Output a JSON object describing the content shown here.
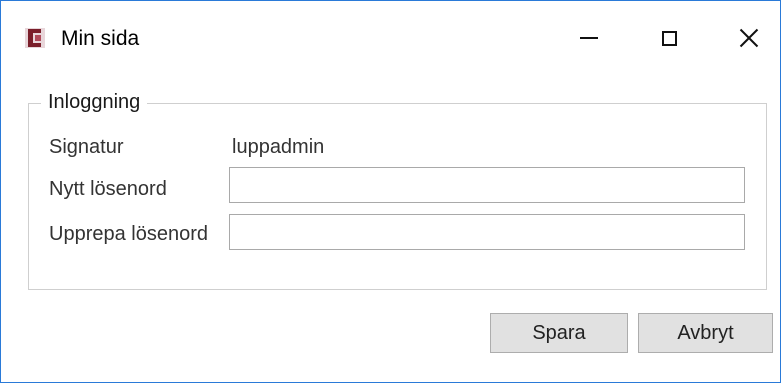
{
  "window": {
    "title": "Min sida",
    "app_icon": "app-icon",
    "controls": {
      "minimize_icon": "minimize-icon",
      "maximize_icon": "maximize-icon",
      "close_icon": "close-icon"
    }
  },
  "login_group": {
    "legend": "Inloggning",
    "signature_label": "Signatur",
    "signature_value": "luppadmin",
    "new_password_label": "Nytt lösenord",
    "new_password_value": "",
    "repeat_password_label": "Upprepa lösenord",
    "repeat_password_value": ""
  },
  "actions": {
    "save_label": "Spara",
    "cancel_label": "Avbryt"
  },
  "colors": {
    "window_border": "#2a7ad8",
    "button_bg": "#e1e1e1",
    "app_icon": "#7a1e2a"
  }
}
